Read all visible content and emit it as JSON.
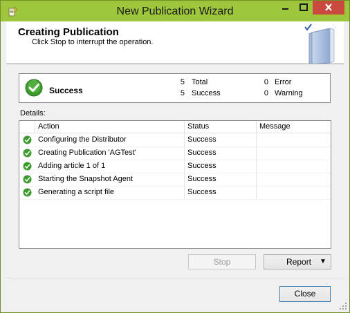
{
  "window": {
    "title": "New Publication Wizard",
    "accent_color": "#9dc63c",
    "close_color": "#c74a3c"
  },
  "header": {
    "title": "Creating Publication",
    "subtitle": "Click Stop to interrupt the operation."
  },
  "summary": {
    "status": "Success",
    "total_count": "5",
    "total_label": "Total",
    "success_count": "5",
    "success_label": "Success",
    "error_count": "0",
    "error_label": "Error",
    "warning_count": "0",
    "warning_label": "Warning"
  },
  "details": {
    "label": "Details:",
    "columns": [
      "Action",
      "Status",
      "Message"
    ],
    "rows": [
      {
        "action": "Configuring the Distributor",
        "status": "Success",
        "message": "",
        "icon": "success-check-icon"
      },
      {
        "action": "Creating Publication 'AGTest'",
        "status": "Success",
        "message": "",
        "icon": "success-check-icon"
      },
      {
        "action": "Adding article 1 of 1",
        "status": "Success",
        "message": "",
        "icon": "success-check-icon"
      },
      {
        "action": "Starting the Snapshot Agent",
        "status": "Success",
        "message": "",
        "icon": "success-check-icon"
      },
      {
        "action": "Generating a script file",
        "status": "Success",
        "message": "",
        "icon": "success-check-icon"
      }
    ]
  },
  "buttons": {
    "stop": "Stop",
    "report": "Report",
    "report_arrow": "▼",
    "close": "Close"
  }
}
